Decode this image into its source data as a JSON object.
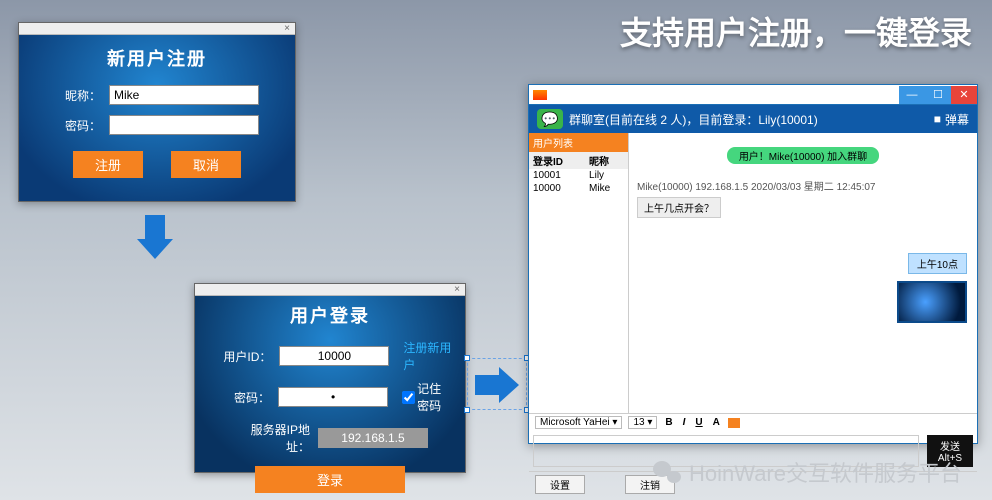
{
  "headline": "支持用户注册，一键登录",
  "register": {
    "title": "新用户注册",
    "nick_label": "昵称：",
    "nick_value": "Mike",
    "pwd_label": "密码：",
    "btn_register": "注册",
    "btn_cancel": "取消"
  },
  "login": {
    "title": "用户登录",
    "uid_label": "用户ID：",
    "uid_value": "10000",
    "pwd_label": "密码：",
    "pwd_value": "•",
    "ip_label": "服务器IP地址：",
    "ip_value": "192.168.1.5",
    "link_register": "注册新用户",
    "chk_remember": "记住密码",
    "btn_login": "登录"
  },
  "chat": {
    "header": "群聊室(目前在线 2 人)，目前登录：Lily(10001)",
    "bullet_label": "弹幕",
    "user_tab": "用户列表",
    "col_id": "登录ID",
    "col_nick": "昵称",
    "users": [
      {
        "id": "10001",
        "nick": "Lily"
      },
      {
        "id": "10000",
        "nick": "Mike"
      }
    ],
    "join_msg": "用户！Mike(10000) 加入群聊",
    "meta": "Mike(10000)   192.168.1.5   2020/03/03 星期二 12:45:07",
    "msg_left": "上午几点开会？",
    "msg_right": "上午10点",
    "font_name": "Microsoft YaHei",
    "font_size": "13",
    "send": "发送",
    "send_hint": "Alt+S",
    "foot_settings": "设置",
    "foot_logout": "注销"
  },
  "watermark": "HoinWare交互软件服务平台"
}
